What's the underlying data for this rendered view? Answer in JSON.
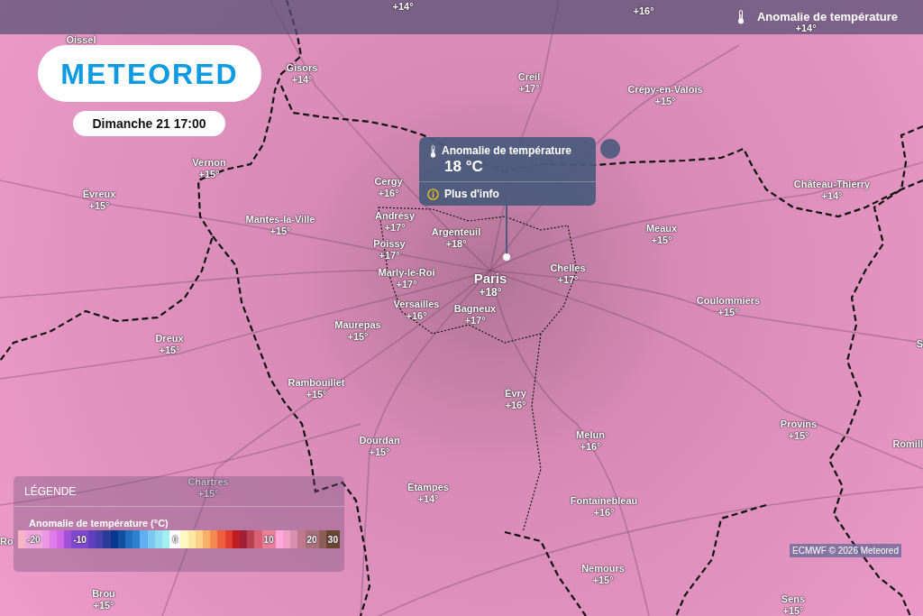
{
  "header": {
    "title": "Anomalie de température"
  },
  "logo": {
    "text": "METEORED"
  },
  "date": "Dimanche 21 17:00",
  "map": {
    "places": [
      {
        "kind": "town",
        "name": "Oissel"
      },
      {
        "kind": "town",
        "temperature": "+14°"
      },
      {
        "kind": "town",
        "temperature": "+16°"
      },
      {
        "kind": "town",
        "temperature": "+14°"
      },
      {
        "kind": "town",
        "name": "Gisors",
        "temperature": "+14°"
      },
      {
        "kind": "town",
        "name": "Creil",
        "temperature": "+17°"
      },
      {
        "kind": "town",
        "name": "Crépy-en-Valois",
        "temperature": "+15°"
      },
      {
        "kind": "town",
        "name": "Vernon",
        "temperature": "+15°"
      },
      {
        "kind": "town",
        "name": "Évreux",
        "temperature": "+15°"
      },
      {
        "kind": "town",
        "name": "Cergy",
        "temperature": "+16°"
      },
      {
        "kind": "town",
        "name": "Château-Thierry",
        "temperature": "+14°"
      },
      {
        "kind": "town",
        "name": "Mantes-la-Ville",
        "temperature": "+15°"
      },
      {
        "kind": "town",
        "name": "Andrésy",
        "temperature": "+17°"
      },
      {
        "kind": "town",
        "name": "Poissy",
        "temperature": "+17°"
      },
      {
        "kind": "town",
        "name": "Argenteuil",
        "temperature": "+18°"
      },
      {
        "kind": "town",
        "name": "Meaux",
        "temperature": "+15°"
      },
      {
        "kind": "town",
        "name": "Marly-le-Roi",
        "temperature": "+17°"
      },
      {
        "kind": "capital",
        "name": "Paris",
        "temperature": "+18°"
      },
      {
        "kind": "town",
        "name": "Chelles",
        "temperature": "+17°"
      },
      {
        "kind": "town",
        "name": "Dreux",
        "temperature": "+15°"
      },
      {
        "kind": "town",
        "name": "Maurepas",
        "temperature": "+15°"
      },
      {
        "kind": "town",
        "name": "Versailles",
        "temperature": "+16°"
      },
      {
        "kind": "town",
        "name": "Bagneux",
        "temperature": "+17°"
      },
      {
        "kind": "town",
        "name": "Coulommiers",
        "temperature": "+15°"
      },
      {
        "kind": "town",
        "name": "S"
      },
      {
        "kind": "town",
        "name": "Rambouillet",
        "temperature": "+15°"
      },
      {
        "kind": "town",
        "name": "Évry",
        "temperature": "+16°"
      },
      {
        "kind": "town",
        "name": "Dourdan",
        "temperature": "+15°"
      },
      {
        "kind": "town",
        "name": "Melun",
        "temperature": "+16°"
      },
      {
        "kind": "town",
        "name": "Provins",
        "temperature": "+15°"
      },
      {
        "kind": "town",
        "name": "Romill"
      },
      {
        "kind": "town",
        "name": "Chartres",
        "temperature": "+15°"
      },
      {
        "kind": "town",
        "name": "Étampes",
        "temperature": "+14°"
      },
      {
        "kind": "town",
        "name": "Fontainebleau",
        "temperature": "+16°"
      },
      {
        "kind": "town",
        "name": "Ro"
      },
      {
        "kind": "town",
        "name": "Nemours",
        "temperature": "+15°"
      },
      {
        "kind": "town",
        "name": "Brou",
        "temperature": "+15°"
      },
      {
        "kind": "town",
        "name": "Sens",
        "temperature": "+15°"
      }
    ]
  },
  "popup": {
    "title": "Anomalie de température",
    "value": "18 °C",
    "link": "Plus d'info"
  },
  "legend": {
    "title": "LÉGENDE",
    "scale_title": "Anomalie de température (°C)",
    "steps": [
      {
        "color": "#f4b4c4"
      },
      {
        "color": "#eea8dc",
        "label": "-20"
      },
      {
        "color": "#e898e4"
      },
      {
        "color": "#e07ce8"
      },
      {
        "color": "#d068e8"
      },
      {
        "color": "#a050d8"
      },
      {
        "color": "#8048d0",
        "label": "-10"
      },
      {
        "color": "#6040c0"
      },
      {
        "color": "#4840a8"
      },
      {
        "color": "#2a3c98"
      },
      {
        "color": "#08388c"
      },
      {
        "color": "#1050a0"
      },
      {
        "color": "#2070c0"
      },
      {
        "color": "#3080d0"
      },
      {
        "color": "#60b0f0"
      },
      {
        "color": "#78c8f0"
      },
      {
        "color": "#90dcf0"
      },
      {
        "color": "#a0f0f0"
      },
      {
        "color": "#ffffff",
        "label": "0"
      },
      {
        "color": "#fff8c0"
      },
      {
        "color": "#fde8a0"
      },
      {
        "color": "#fcd088"
      },
      {
        "color": "#f8b068"
      },
      {
        "color": "#f48850"
      },
      {
        "color": "#ec6040"
      },
      {
        "color": "#e03c30"
      },
      {
        "color": "#c01c28"
      },
      {
        "color": "#a02038"
      },
      {
        "color": "#b84050"
      },
      {
        "color": "#d86070"
      },
      {
        "color": "#e88098",
        "label": "10"
      },
      {
        "color": "#ffa8dc"
      },
      {
        "color": "#f0a0c8"
      },
      {
        "color": "#d890b0"
      },
      {
        "color": "#c07890"
      },
      {
        "color": "#a87078",
        "label": "20"
      },
      {
        "color": "#8c5c58"
      },
      {
        "color": "#6a4630",
        "label": "30"
      }
    ]
  },
  "attribution": "ECMWF © 2026 Meteored"
}
